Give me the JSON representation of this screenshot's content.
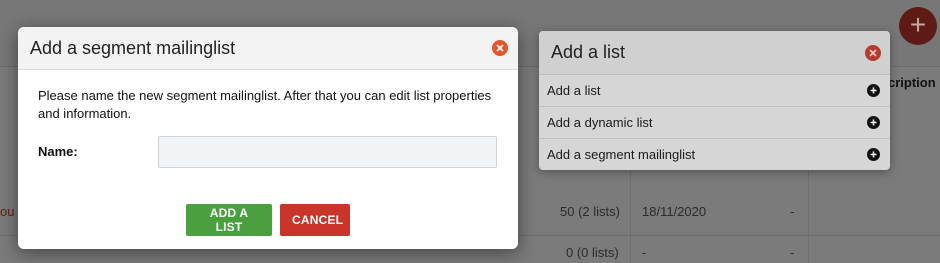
{
  "modal": {
    "title": "Add a segment mailinglist",
    "description": "Please name the new segment mailinglist. After that you can edit list properties and information.",
    "name_label": "Name:",
    "name_value": "",
    "add_button": "ADD A LIST",
    "cancel_button": "CANCEL"
  },
  "panel": {
    "title": "Add a list",
    "items": [
      {
        "label": "Add a list"
      },
      {
        "label": "Add a dynamic list"
      },
      {
        "label": "Add a segment mailinglist"
      }
    ]
  },
  "background": {
    "header_partial": "cription",
    "red_text_partial": "ou",
    "rows": [
      {
        "count": "50 (2 lists)",
        "date": "18/11/2020",
        "extra": "-"
      },
      {
        "count": "0 (0 lists)",
        "date": "-",
        "extra": "-"
      }
    ]
  },
  "colors": {
    "accent_green": "#4aa03f",
    "accent_red": "#c9342b",
    "close_orange": "#e8542d"
  },
  "icons": [
    "plus-icon",
    "close-icon"
  ]
}
